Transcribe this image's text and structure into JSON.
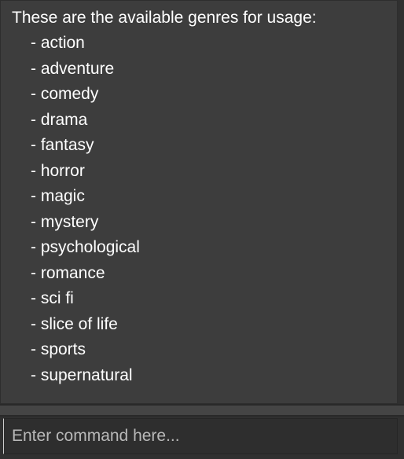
{
  "output": {
    "heading": "These are the available genres for usage:",
    "genres": [
      "- action",
      "- adventure",
      "- comedy",
      "- drama",
      "- fantasy",
      "- horror",
      "- magic",
      "- mystery",
      "- psychological",
      "- romance",
      "- sci fi",
      "- slice of life",
      "- sports",
      "- supernatural"
    ]
  },
  "command": {
    "value": "",
    "placeholder": "Enter command here..."
  },
  "colors": {
    "background": "#3d3d3d",
    "text": "#ffffff",
    "input_background": "#2e2e2e"
  }
}
